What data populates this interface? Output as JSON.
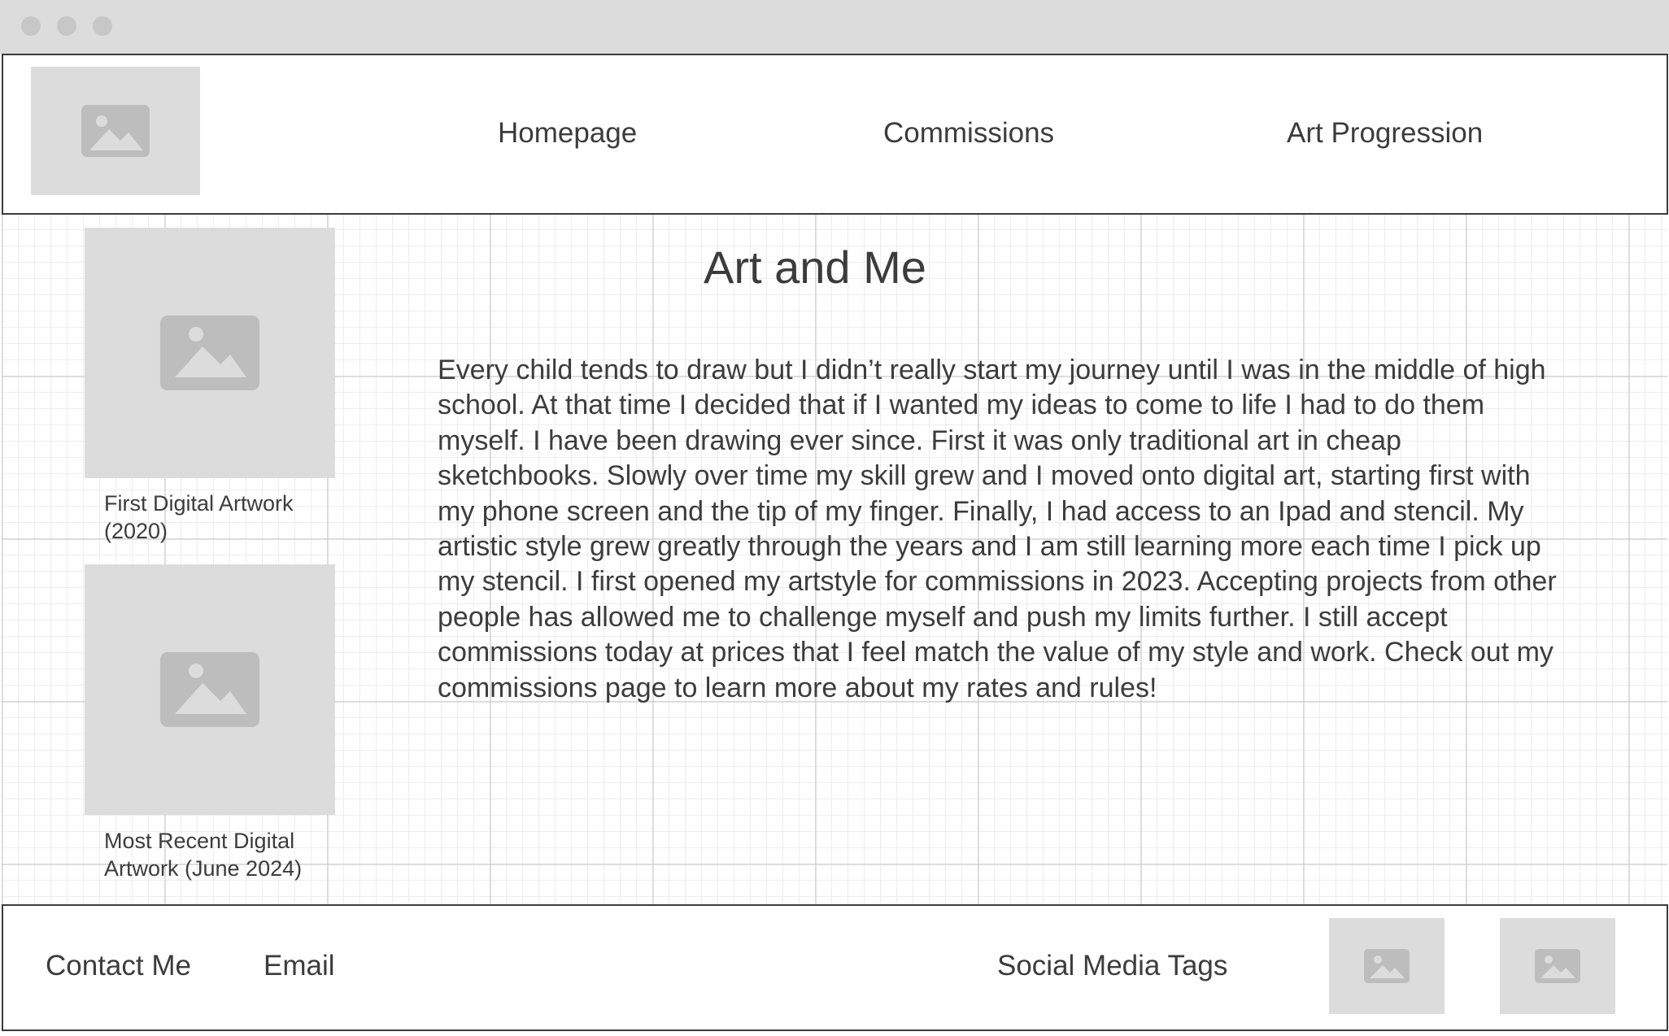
{
  "window": {
    "controls": [
      "close",
      "minimize",
      "maximize"
    ]
  },
  "header": {
    "logo_icon": "image-placeholder-icon",
    "nav": [
      {
        "label": "Homepage"
      },
      {
        "label": "Commissions"
      },
      {
        "label": "Art Progression"
      }
    ]
  },
  "main": {
    "title": "Art and Me",
    "body": "Every child tends to draw but I didn’t really start my journey until I was in the middle of high school. At that time I decided that if I wanted my ideas to come to life I had to do them myself. I have been drawing ever since. First it was only traditional art in cheap sketchbooks. Slowly over time my skill grew and I moved onto digital art, starting first with my phone screen and the tip of my finger. Finally, I had access to an Ipad and stencil. My artistic style grew greatly through the years and I am still learning more each time I pick up my stencil. I first opened my artstyle for commissions in 2023. Accepting projects from other people has allowed me to challenge myself and push my limits further. I still accept commissions today at prices that I feel match the value of my style and work. Check out my commissions page to learn more about my rates and rules!",
    "artworks": [
      {
        "caption": "First Digital Artwork (2020)",
        "icon": "image-placeholder-icon"
      },
      {
        "caption": "Most Recent Digital Artwork (June 2024)",
        "icon": "image-placeholder-icon"
      }
    ]
  },
  "footer": {
    "contact_label": "Contact Me",
    "email_label": "Email",
    "social_label": "Social Media Tags",
    "social_icons": [
      "image-placeholder-icon",
      "image-placeholder-icon"
    ]
  },
  "colors": {
    "text": "#3c3c3c",
    "placeholder_bg": "#dcdcdc",
    "placeholder_icon": "#bdbdbd",
    "titlebar": "#dcdcdc",
    "border": "#3c3c3c"
  }
}
